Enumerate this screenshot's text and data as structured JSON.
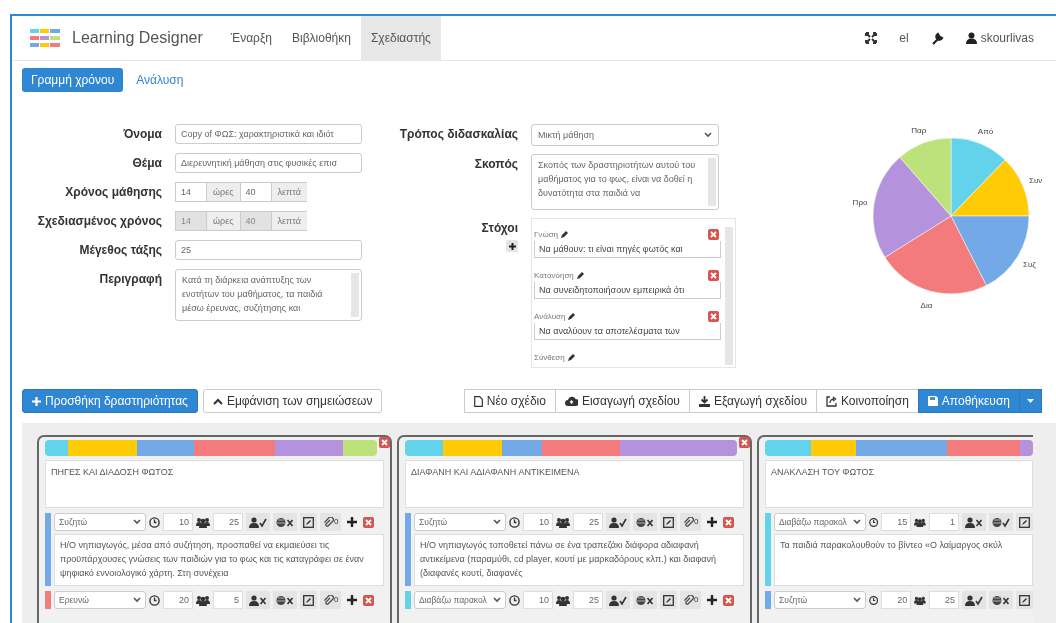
{
  "app": {
    "title": "Learning Designer"
  },
  "nav": [
    {
      "label": "Έναρξη",
      "selected": false
    },
    {
      "label": "Βιβλιοθήκη",
      "selected": false
    },
    {
      "label": "Σχεδιαστής",
      "selected": true
    }
  ],
  "user_menu": {
    "language": "el",
    "username": "skourlivas"
  },
  "view_tabs": [
    {
      "label": "Γραμμή χρόνου",
      "selected": true
    },
    {
      "label": "Ανάλυση",
      "selected": false
    }
  ],
  "details": [
    {
      "kind": "text",
      "label": "Όνομα",
      "value": "Copy of ΦΩΣ: χαρακτηριστικά και ιδιότ"
    },
    {
      "kind": "text",
      "label": "Θέμα",
      "value": "Διερευνητική μάθηση στις φυσικές επισ"
    },
    {
      "kind": "time",
      "label": "Χρόνος μάθησης",
      "hours": "14",
      "hours_unit": "ώρες",
      "minutes": "40",
      "minutes_unit": "λεπτά",
      "disabled": false
    },
    {
      "kind": "time",
      "label": "Σχεδιασμένος χρόνος",
      "hours": "14",
      "hours_unit": "ώρες",
      "minutes": "40",
      "minutes_unit": "λεπτά",
      "disabled": true
    },
    {
      "kind": "text",
      "label": "Μέγεθος τάξης",
      "value": "25"
    },
    {
      "kind": "textarea",
      "label": "Περιγραφή",
      "value": "Κατά τη διάρκεια ανάπτυξης των ενοτήτων του μαθήματος, τα παιδιά μέσω έρευνας, συζήτησης και"
    }
  ],
  "teaching": {
    "approach": {
      "label": "Τρόπος διδασκαλίας",
      "value": "Μικτή μάθηση"
    },
    "aim": {
      "label": "Σκοπός",
      "value": "Σκοπός των δραστηριοτήτων αυτού του μαθήματος για το φως, είναι να δοθεί η δυνατότητα στα παιδιά να"
    },
    "outcomes": {
      "label": "Στόχοι",
      "items": [
        {
          "label": "Γνώση",
          "text": "Να μάθουν: τι είναι πηγές φωτός και"
        },
        {
          "label": "Κατανόηση",
          "text": "Να συνειδητοποιήσουν εμπειρικά ότι"
        },
        {
          "label": "Ανάλυση",
          "text": "Να αναλύουν τα αποτελέσματα των"
        },
        {
          "label": "Σύνθεση"
        }
      ]
    }
  },
  "learning_types": {
    "slices": [
      {
        "label": "Από",
        "color": "#63d3ec"
      },
      {
        "label": "Συν",
        "color": "#ffcb05"
      },
      {
        "label": "Συζ",
        "color": "#72a9e6"
      },
      {
        "label": "Δια",
        "color": "#f47b7b"
      },
      {
        "label": "Προ",
        "color": "#b593dc"
      },
      {
        "label": "Παρ",
        "color": "#bde27b"
      }
    ]
  },
  "toolbar_left": [
    {
      "label": "Προσθήκη δραστηριότητας"
    },
    {
      "label": "Εμφάνιση των σημειώσεων"
    }
  ],
  "toolbar_right": [
    {
      "label": "Νέο σχέδιο"
    },
    {
      "label": "Εισαγωγή σχεδίου"
    },
    {
      "label": "Εξαγωγή σχεδίου"
    },
    {
      "label": "Κοινοποίηση"
    },
    {
      "label": "Αποθήκευση"
    }
  ],
  "cards": [
    {
      "title": "ΠΗΓΕΣ ΚΑΙ ΔΙΑΔΟΣΗ ΦΩΤΟΣ",
      "removable": true,
      "bar": [
        {
          "color": "#63d3ec"
        },
        {
          "color": "#ffcb05"
        },
        {
          "color": "#72a9e6"
        },
        {
          "color": "#f47b7b"
        },
        {
          "color": "#b593dc"
        },
        {
          "color": "#bde27b"
        }
      ],
      "activities": [
        {
          "color": "#72a9e6",
          "type": "Συζητώ",
          "minutes": "10",
          "group_size": "25",
          "tools": [
            {
              "kind": "teacher",
              "on": true
            },
            {
              "kind": "online",
              "on": false
            },
            {
              "kind": "notes"
            },
            {
              "kind": "attach",
              "count": "0"
            },
            {
              "kind": "add"
            },
            {
              "kind": "remove"
            }
          ],
          "description": "Η/Ο νηπιαγωγός, μέσα από συζήτηση, προσπαθεί να εκμαιεύσει τις προϋπάρχουσες γνώσεις των παιδιών για το φως και τις καταγράφει σε έναν ψηφιακό εννοιολογικό χάρτη. Στη συνέχεια"
        },
        {
          "color": "#f47b7b",
          "type": "Ερευνώ",
          "minutes": "20",
          "group_size": "5",
          "tools": [
            {
              "kind": "teacher",
              "on": false
            },
            {
              "kind": "online",
              "on": false
            },
            {
              "kind": "notes"
            },
            {
              "kind": "attach",
              "count": "0"
            },
            {
              "kind": "add"
            },
            {
              "kind": "remove"
            }
          ]
        }
      ]
    },
    {
      "title": "ΔΙΑΦΑΝΗ ΚΑΙ ΑΔΙΑΦΑΝΗ ΑΝΤΙΚΕΙΜΕΝΑ",
      "removable": true,
      "bar": [
        {
          "color": "#63d3ec"
        },
        {
          "color": "#ffcb05"
        },
        {
          "color": "#72a9e6"
        },
        {
          "color": "#f47b7b"
        },
        {
          "color": "#b593dc"
        }
      ],
      "activities": [
        {
          "color": "#72a9e6",
          "type": "Συζητώ",
          "minutes": "10",
          "group_size": "25",
          "tools": [
            {
              "kind": "teacher",
              "on": true
            },
            {
              "kind": "online",
              "on": false
            },
            {
              "kind": "notes"
            },
            {
              "kind": "attach",
              "count": "0"
            },
            {
              "kind": "add"
            },
            {
              "kind": "remove"
            }
          ],
          "description": "Η/Ο νηπιαγωγός τοποθετεί πάνω σε ένα τραπεζάκι διάφορα αδιαφανή αντικείμενα (παραμύθι, cd player, κουτί με μαρκαδόρους κλπ.) και διαφανή (διαφανές κουτί, διαφανές"
        },
        {
          "color": "#63d3ec",
          "type": "Διαβάζω παρακολ",
          "minutes": "10",
          "group_size": "25",
          "tools": [
            {
              "kind": "teacher",
              "on": true
            },
            {
              "kind": "online",
              "on": false
            },
            {
              "kind": "notes"
            },
            {
              "kind": "attach",
              "count": "0"
            },
            {
              "kind": "add"
            },
            {
              "kind": "remove"
            }
          ]
        }
      ]
    },
    {
      "title": "ΑΝΑΚΛΑΣΗ ΤΟΥ ΦΩΤΟΣ",
      "bar": [
        {
          "color": "#63d3ec"
        },
        {
          "color": "#ffcb05"
        },
        {
          "color": "#72a9e6"
        },
        {
          "color": "#f47b7b"
        },
        {
          "color": "#b593dc"
        }
      ],
      "activities": [
        {
          "color": "#63d3ec",
          "type": "Διαβάζω παρακολ",
          "minutes": "15",
          "group_size": "1",
          "tools": [
            {
              "kind": "teacher",
              "on": false
            },
            {
              "kind": "online",
              "on": true
            },
            {
              "kind": "notes"
            }
          ],
          "description": "Τα παιδιά παρακολουθούν το βίντεο «Ο λαίμαργος σκύλ"
        },
        {
          "color": "#72a9e6",
          "type": "Συζητώ",
          "minutes": "20",
          "group_size": "25",
          "tools": [
            {
              "kind": "teacher",
              "on": true
            },
            {
              "kind": "online",
              "on": false
            },
            {
              "kind": "notes"
            }
          ]
        }
      ]
    }
  ]
}
